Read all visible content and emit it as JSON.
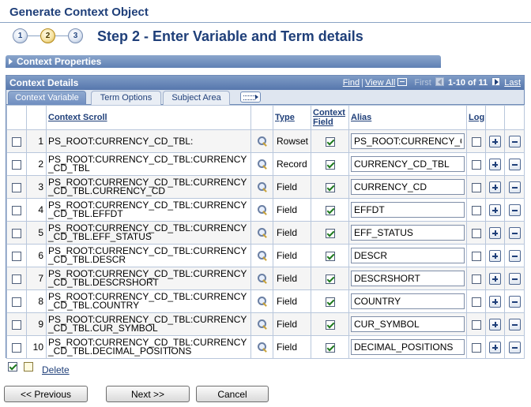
{
  "page": {
    "title": "Generate Context Object"
  },
  "steps": {
    "items": [
      "1",
      "2",
      "3"
    ],
    "current_index": 1,
    "heading": "Step 2 - Enter Variable and Term details"
  },
  "context_properties": {
    "label": "Context Properties"
  },
  "context_details": {
    "label": "Context Details",
    "nav": {
      "find": "Find",
      "view_all": "View All",
      "first": "First",
      "range": "1-10 of 11",
      "last": "Last"
    },
    "tabs": [
      "Context Variable",
      "Term Options",
      "Subject Area"
    ],
    "active_tab": 0,
    "columns": {
      "context_scroll": "Context Scroll",
      "type": "Type",
      "context_field": "Context Field",
      "alias": "Alias",
      "log": "Log"
    },
    "rows": [
      {
        "num": "1",
        "scroll": "PS_ROOT:CURRENCY_CD_TBL:",
        "type": "Rowset",
        "context_field": true,
        "alias": "PS_ROOT:CURRENCY_CD_TBL",
        "log": false
      },
      {
        "num": "2",
        "scroll": "PS_ROOT:CURRENCY_CD_TBL:CURRENCY_CD_TBL",
        "type": "Record",
        "context_field": true,
        "alias": "CURRENCY_CD_TBL",
        "log": false
      },
      {
        "num": "3",
        "scroll": "PS_ROOT:CURRENCY_CD_TBL:CURRENCY_CD_TBL.CURRENCY_CD",
        "type": "Field",
        "context_field": true,
        "alias": "CURRENCY_CD",
        "log": false
      },
      {
        "num": "4",
        "scroll": "PS_ROOT:CURRENCY_CD_TBL:CURRENCY_CD_TBL.EFFDT",
        "type": "Field",
        "context_field": true,
        "alias": "EFFDT",
        "log": false
      },
      {
        "num": "5",
        "scroll": "PS_ROOT:CURRENCY_CD_TBL:CURRENCY_CD_TBL.EFF_STATUS",
        "type": "Field",
        "context_field": true,
        "alias": "EFF_STATUS",
        "log": false
      },
      {
        "num": "6",
        "scroll": "PS_ROOT:CURRENCY_CD_TBL:CURRENCY_CD_TBL.DESCR",
        "type": "Field",
        "context_field": true,
        "alias": "DESCR",
        "log": false
      },
      {
        "num": "7",
        "scroll": "PS_ROOT:CURRENCY_CD_TBL:CURRENCY_CD_TBL.DESCRSHORT",
        "type": "Field",
        "context_field": true,
        "alias": "DESCRSHORT",
        "log": false
      },
      {
        "num": "8",
        "scroll": "PS_ROOT:CURRENCY_CD_TBL:CURRENCY_CD_TBL.COUNTRY",
        "type": "Field",
        "context_field": true,
        "alias": "COUNTRY",
        "log": false
      },
      {
        "num": "9",
        "scroll": "PS_ROOT:CURRENCY_CD_TBL:CURRENCY_CD_TBL.CUR_SYMBOL",
        "type": "Field",
        "context_field": true,
        "alias": "CUR_SYMBOL",
        "log": false
      },
      {
        "num": "10",
        "scroll": "PS_ROOT:CURRENCY_CD_TBL:CURRENCY_CD_TBL.DECIMAL_POSITIONS",
        "type": "Field",
        "context_field": true,
        "alias": "DECIMAL_POSITIONS",
        "log": false
      }
    ]
  },
  "actions": {
    "delete": "Delete",
    "previous": "<< Previous",
    "next": "Next >>",
    "cancel": "Cancel"
  },
  "colors": {
    "title": "#1f3f79",
    "header_bar": "#5f80b4"
  },
  "icons": {
    "lookup": "search-icon",
    "add_row": "plus-icon",
    "delete_row": "minus-icon"
  }
}
